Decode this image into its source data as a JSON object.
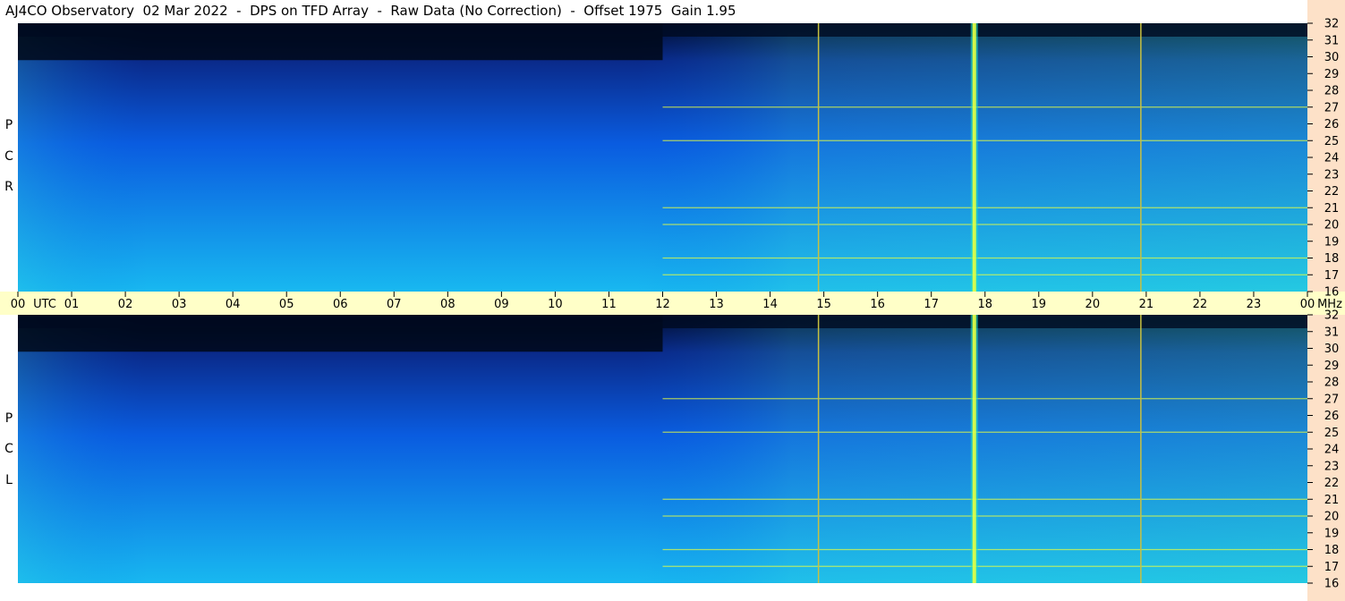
{
  "title": "AJ4CO Observatory  02 Mar 2022  -  DPS on TFD Array  -  Raw Data (No Correction)  -  Offset 1975  Gain 1.95",
  "panels": [
    {
      "name": "rcp-panel",
      "label_letters": [
        "R",
        "C",
        "P"
      ]
    },
    {
      "name": "lcp-panel",
      "label_letters": [
        "L",
        "C",
        "P"
      ]
    }
  ],
  "time_axis": {
    "ticks": [
      "00",
      "01",
      "02",
      "03",
      "04",
      "05",
      "06",
      "07",
      "08",
      "09",
      "10",
      "11",
      "12",
      "13",
      "14",
      "15",
      "16",
      "17",
      "18",
      "19",
      "20",
      "21",
      "22",
      "23",
      "00"
    ],
    "unit_label": "UTC",
    "freq_unit": "MHz"
  },
  "colors": {
    "right_strip": "#fde1c8",
    "time_band": "#ffffc8",
    "spectrogram_low": "#000a2a",
    "spectrogram_mid": "#0a5ce0",
    "spectrogram_high": "#40e0ff",
    "rfi_bright": "#e8ff40"
  },
  "chart_data": [
    {
      "type": "heatmap",
      "title": "",
      "panel": "RCP",
      "xlabel": "UTC",
      "ylabel": "MHz",
      "x_ticks": [
        "00",
        "01",
        "02",
        "03",
        "04",
        "05",
        "06",
        "07",
        "08",
        "09",
        "10",
        "11",
        "12",
        "13",
        "14",
        "15",
        "16",
        "17",
        "18",
        "19",
        "20",
        "21",
        "22",
        "23",
        "00"
      ],
      "y_ticks": [
        16,
        17,
        18,
        19,
        20,
        21,
        22,
        23,
        24,
        25,
        26,
        27,
        28,
        29,
        30,
        31,
        32
      ],
      "ylim": [
        16,
        32
      ],
      "xlim_hours": [
        0,
        24
      ],
      "features": {
        "vertical_lines_utc": [
          14.9,
          20.9
        ],
        "bright_burst_utc": 17.8,
        "dark_top_region_utc": [
          0,
          12
        ],
        "rfi_lines_mhz": [
          17.0,
          18.0,
          20.0,
          21.0,
          25.0,
          27.0
        ]
      }
    },
    {
      "type": "heatmap",
      "title": "",
      "panel": "LCP",
      "xlabel": "UTC",
      "ylabel": "MHz",
      "x_ticks": [
        "00",
        "01",
        "02",
        "03",
        "04",
        "05",
        "06",
        "07",
        "08",
        "09",
        "10",
        "11",
        "12",
        "13",
        "14",
        "15",
        "16",
        "17",
        "18",
        "19",
        "20",
        "21",
        "22",
        "23",
        "00"
      ],
      "y_ticks": [
        16,
        17,
        18,
        19,
        20,
        21,
        22,
        23,
        24,
        25,
        26,
        27,
        28,
        29,
        30,
        31,
        32
      ],
      "ylim": [
        16,
        32
      ],
      "xlim_hours": [
        0,
        24
      ],
      "features": {
        "vertical_lines_utc": [
          14.9,
          20.9
        ],
        "bright_burst_utc": 17.8,
        "dark_top_region_utc": [
          0,
          12
        ],
        "rfi_lines_mhz": [
          17.0,
          18.0,
          20.0,
          21.0,
          25.0,
          27.0
        ]
      }
    }
  ]
}
